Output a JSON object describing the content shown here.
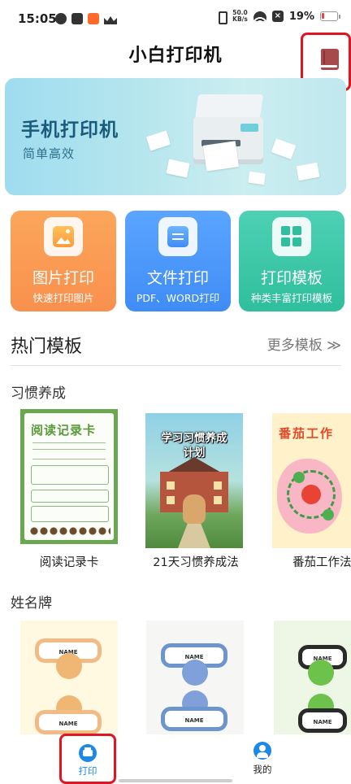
{
  "status_bar": {
    "time": "15:05",
    "net_speed_value": "50.0",
    "net_speed_unit": "KB/s",
    "battery_percent": "19%",
    "battery_level": 0.19,
    "battery_color": "#f04040"
  },
  "header": {
    "title": "小白打印机",
    "book_icon": "book-icon"
  },
  "banner": {
    "title": "手机打印机",
    "subtitle": "简单高效"
  },
  "features": [
    {
      "title": "图片打印",
      "subtitle": "快速打印图片",
      "icon": "image-icon",
      "color": "#f9904d"
    },
    {
      "title": "文件打印",
      "subtitle": "PDF、WORD打印",
      "icon": "file-icon",
      "color": "#3f8cf6"
    },
    {
      "title": "打印模板",
      "subtitle": "种类丰富打印模板",
      "icon": "grid-icon",
      "color": "#2fbf9c"
    }
  ],
  "hot_templates": {
    "title": "热门模板",
    "more": "更多模板 ≫"
  },
  "categories": [
    {
      "title": "习惯养成",
      "items": [
        {
          "label": "阅读记录卡",
          "thumb_text": "阅读记录卡"
        },
        {
          "label": "21天习惯养成法",
          "thumb_text": "学习习惯养成计划"
        },
        {
          "label": "番茄工作法",
          "thumb_text": "番茄工作"
        }
      ]
    },
    {
      "title": "姓名牌",
      "items": [
        {
          "thumb_text": "NAME"
        },
        {
          "thumb_text": "NAME"
        },
        {
          "thumb_text": "NAME"
        }
      ]
    }
  ],
  "bottom_nav": [
    {
      "label": "打印",
      "icon": "printer-icon",
      "active": true,
      "color": "#1e88e5"
    },
    {
      "label": "我的",
      "icon": "user-icon",
      "active": false
    }
  ],
  "highlight_color": "#e0151f"
}
